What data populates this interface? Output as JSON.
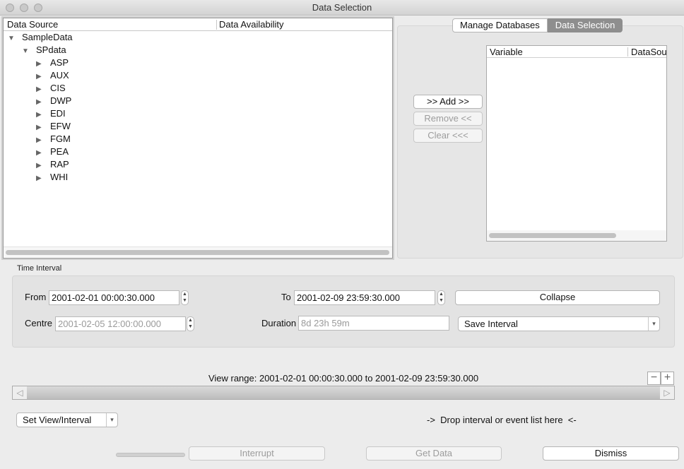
{
  "window": {
    "title": "Data Selection"
  },
  "tree": {
    "columns": [
      "Data Source",
      "Data Availability"
    ],
    "root": "SampleData",
    "child": "SPdata",
    "items": [
      "ASP",
      "AUX",
      "CIS",
      "DWP",
      "EDI",
      "EFW",
      "FGM",
      "PEA",
      "RAP",
      "WHI"
    ],
    "expanded_icon": "triangle-down-icon",
    "collapsed_icon": "triangle-right-icon"
  },
  "tabs": [
    "Manage Databases",
    "Data Selection"
  ],
  "active_tab": "Data Selection",
  "actions": {
    "add": ">> Add >>",
    "remove": "Remove <<",
    "clear": "Clear <<<"
  },
  "variable_table": {
    "columns": [
      "Variable",
      "DataSou"
    ]
  },
  "time_interval": {
    "label": "Time Interval",
    "from_label": "From",
    "from_value": "2001-02-01 00:00:30.000",
    "to_label": "To",
    "to_value": "2001-02-09 23:59:30.000",
    "collapse_label": "Collapse",
    "centre_label": "Centre",
    "centre_value": "2001-02-05 12:00:00.000",
    "duration_label": "Duration",
    "duration_value": "8d 23h 59m",
    "save_interval_label": "Save Interval"
  },
  "view": {
    "range_text": "View range: 2001-02-01 00:00:30.000 to 2001-02-09 23:59:30.000",
    "zoom_out": "−",
    "zoom_in": "+",
    "left_arrow": "◁",
    "right_arrow": "▷"
  },
  "bottom": {
    "set_view_label": "Set View/Interval",
    "drop_text": "->  Drop interval or event list here  <-",
    "interrupt": "Interrupt",
    "get_data": "Get Data",
    "dismiss": "Dismiss"
  },
  "colors": {
    "active_tab_bg": "#8e8e8e",
    "window_bg": "#ececec",
    "slider": "#c4c4c4"
  }
}
